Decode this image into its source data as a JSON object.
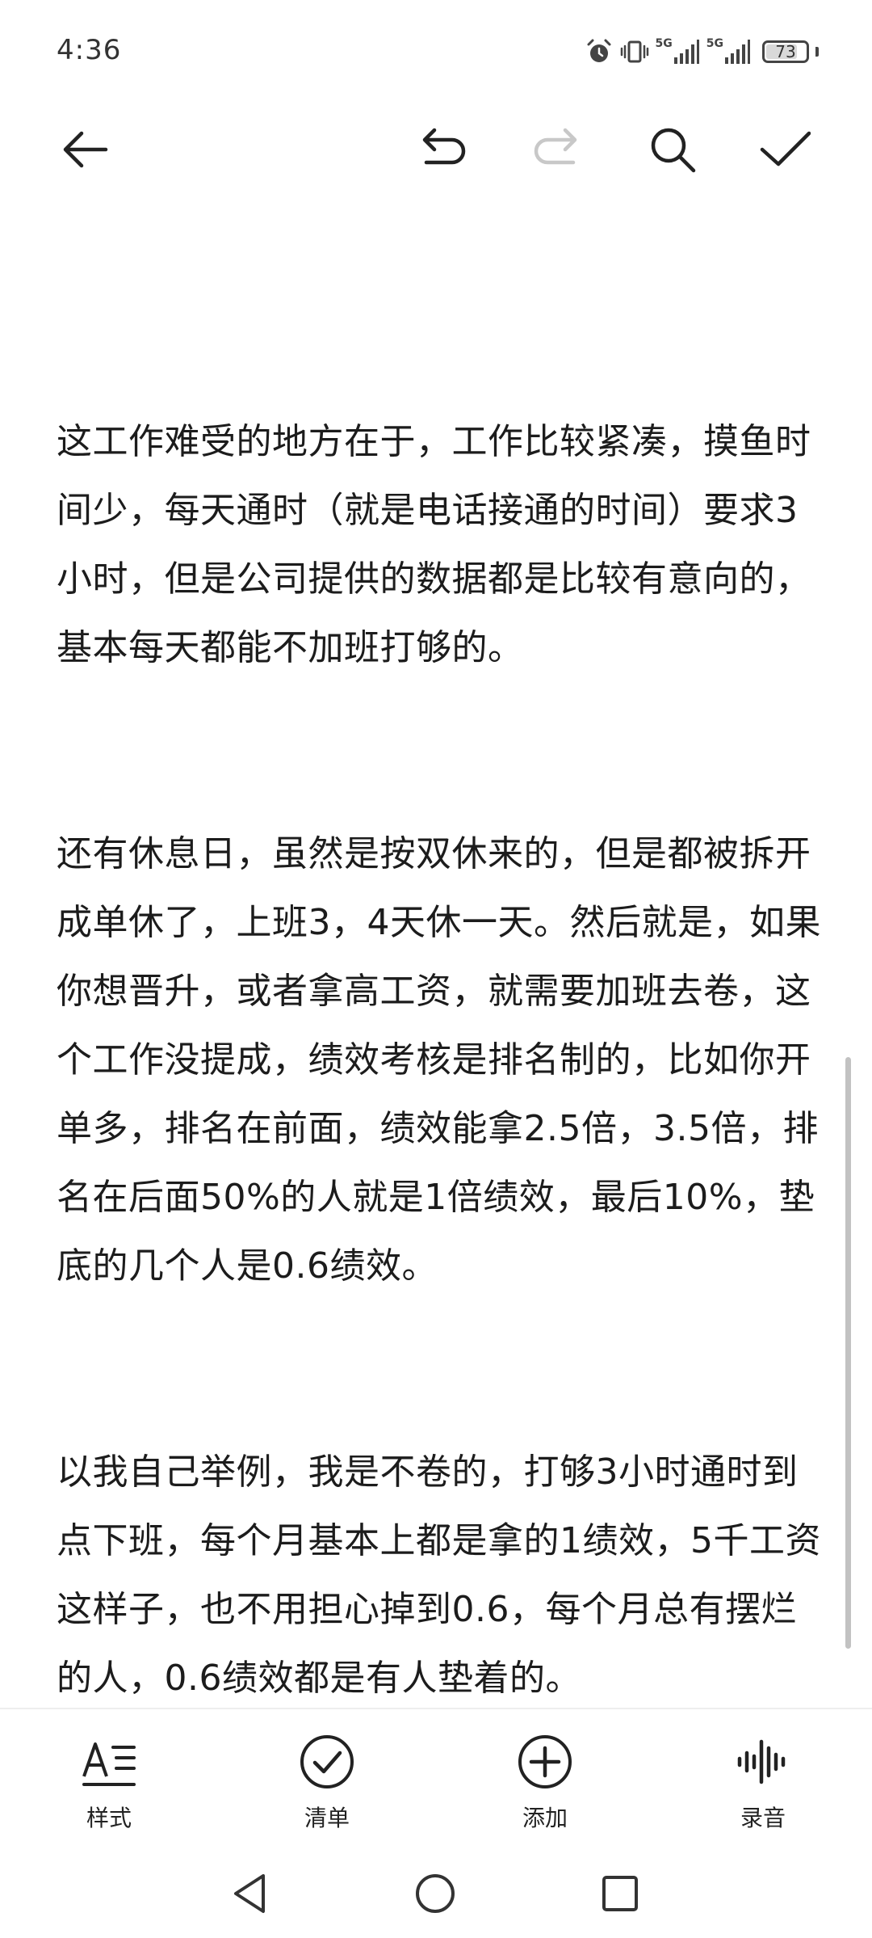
{
  "status_bar": {
    "time": "4:36",
    "network_1": "5G",
    "network_2": "5G",
    "battery_level": "73",
    "icons": [
      "alarm-icon",
      "vibrate-icon",
      "signal-5g-icon",
      "signal-5g-icon",
      "battery-icon"
    ]
  },
  "toolbar": {
    "icons": [
      "back-arrow-icon",
      "undo-icon",
      "redo-icon",
      "search-icon",
      "checkmark-icon"
    ],
    "redo_enabled": false
  },
  "note": {
    "paragraphs": [
      "这工作难受的地方在于，工作比较紧凑，摸鱼时间少，每天通时（就是电话接通的时间）要求3小时，但是公司提供的数据都是比较有意向的，基本每天都能不加班打够的。",
      "还有休息日，虽然是按双休来的，但是都被拆开成单休了，上班3，4天休一天。然后就是，如果你想晋升，或者拿高工资，就需要加班去卷，这个工作没提成，绩效考核是排名制的，比如你开单多，排名在前面，绩效能拿2.5倍，3.5倍，排名在后面50%的人就是1倍绩效，最后10%，垫底的几个人是0.6绩效。",
      "以我自己举例，我是不卷的，打够3小时通时到点下班，每个月基本上都是拿的1绩效，5千工资这样子，也不用担心掉到0.6，每个月总有摆烂的人，0.6绩效都是有人垫着的。"
    ]
  },
  "bottom_toolbar": {
    "items": [
      {
        "label": "样式",
        "icon": "text-style-icon"
      },
      {
        "label": "清单",
        "icon": "checklist-icon"
      },
      {
        "label": "添加",
        "icon": "add-icon"
      },
      {
        "label": "录音",
        "icon": "audio-record-icon"
      }
    ]
  },
  "nav_bar": {
    "icons": [
      "nav-back-icon",
      "nav-home-icon",
      "nav-recents-icon"
    ]
  },
  "colors": {
    "text": "#1c1c1c",
    "icon": "#222222",
    "disabled_icon": "#c8c8c8",
    "scrollbar": "#c2c2c2"
  }
}
